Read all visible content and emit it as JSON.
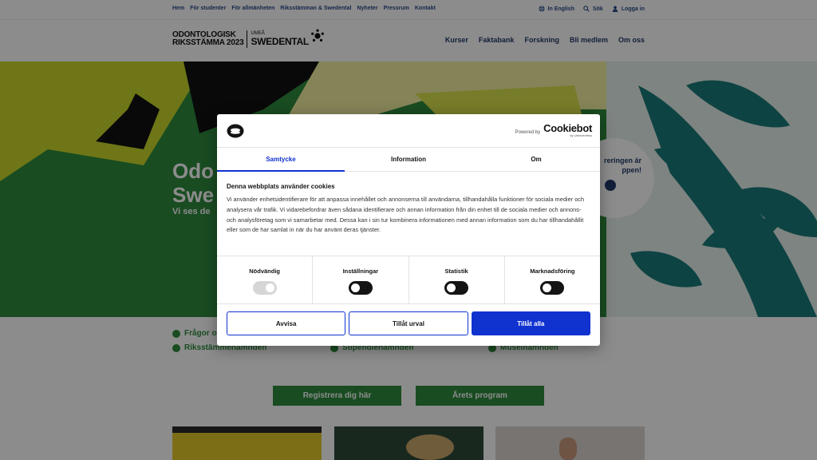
{
  "topbar": {
    "links": [
      "Hem",
      "För studenter",
      "För allmänheten",
      "Riksstämman & Swedental",
      "Nyheter",
      "Pressrum",
      "Kontakt"
    ],
    "language": "In English",
    "search": "Sök",
    "login": "Logga in"
  },
  "header": {
    "logo_line1": "ODONTOLOGISK",
    "logo_line2": "RIKSSTÄMMA 2023",
    "logo_city": "UMEÅ",
    "logo_brand": "SWEDENTAL",
    "nav": [
      "Kurser",
      "Faktabank",
      "Forskning",
      "Bli medlem",
      "Om oss"
    ]
  },
  "hero": {
    "title_line1": "Odo",
    "title_line2": "Swe",
    "subtitle": "Vi ses de",
    "badge_line1": "reringen är",
    "badge_line2": "ppen!"
  },
  "links": {
    "col1": [
      "Frågor o",
      "Riksstämmenämnden"
    ],
    "col2": [
      "Stipendienämnden"
    ],
    "col3": [
      "Museinämnden"
    ]
  },
  "buttons": {
    "register": "Registrera dig här",
    "program": "Årets program"
  },
  "cookie": {
    "powered_by": "Powered by",
    "brand": "Cookiebot",
    "brand_sub": "by Usercentrics",
    "tabs": [
      "Samtycke",
      "Information",
      "Om"
    ],
    "heading": "Denna webbplats använder cookies",
    "body": "Vi använder enhetsidentifierare för att anpassa innehållet och annonserna till användarna, tillhandahålla funktioner för sociala medier och analysera vår trafik. Vi vidarebefordrar även sådana identifierare och annan information från din enhet till de sociala medier och annons- och analysföretag som vi samarbetar med. Dessa kan i sin tur kombinera informationen med annan information som du har tillhandahållit eller som de har samlat in när du har använt deras tjänster.",
    "toggles": [
      {
        "label": "Nödvändig",
        "state": "on-disabled"
      },
      {
        "label": "Inställningar",
        "state": "off"
      },
      {
        "label": "Statistik",
        "state": "off"
      },
      {
        "label": "Marknadsföring",
        "state": "off"
      }
    ],
    "btn_deny": "Avvisa",
    "btn_selection": "Tillåt urval",
    "btn_allow": "Tillåt alla"
  },
  "colors": {
    "primary_blue": "#1032cf",
    "site_green": "#2e8a3c",
    "navy": "#1f3a68"
  }
}
